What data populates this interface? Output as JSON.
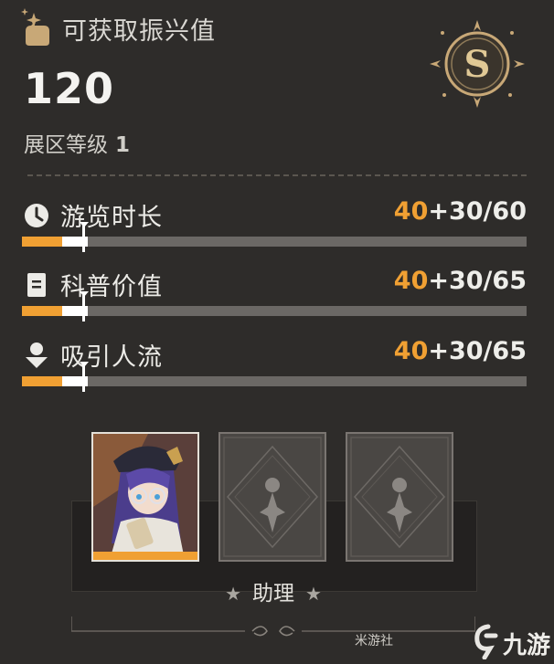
{
  "header": {
    "icon": "hand-stars-icon",
    "title": "可获取振兴值",
    "score": "120",
    "level_label": "展区等级",
    "level_value": "1",
    "badge_letter": "S"
  },
  "stats": [
    {
      "icon": "clock-icon",
      "label": "游览时长",
      "base": "40",
      "rest": "+30/60",
      "base_fraction": 0.0797,
      "after_fraction": 0.1313
    },
    {
      "icon": "document-icon",
      "label": "科普价值",
      "base": "40",
      "rest": "+30/65",
      "base_fraction": 0.0797,
      "after_fraction": 0.1313
    },
    {
      "icon": "person-icon",
      "label": "吸引人流",
      "base": "40",
      "rest": "+30/65",
      "base_fraction": 0.0797,
      "after_fraction": 0.1313
    }
  ],
  "assistant": {
    "label": "助理",
    "star_glyph": "★",
    "slots": [
      {
        "state": "filled"
      },
      {
        "state": "empty"
      },
      {
        "state": "empty"
      }
    ]
  },
  "watermark": {
    "text": "米游社",
    "logo_text": "九游"
  },
  "colors": {
    "background": "#2e2c2a",
    "accent_orange": "#f0a033",
    "track_gray": "#6b6865",
    "gold": "#c8a877"
  }
}
